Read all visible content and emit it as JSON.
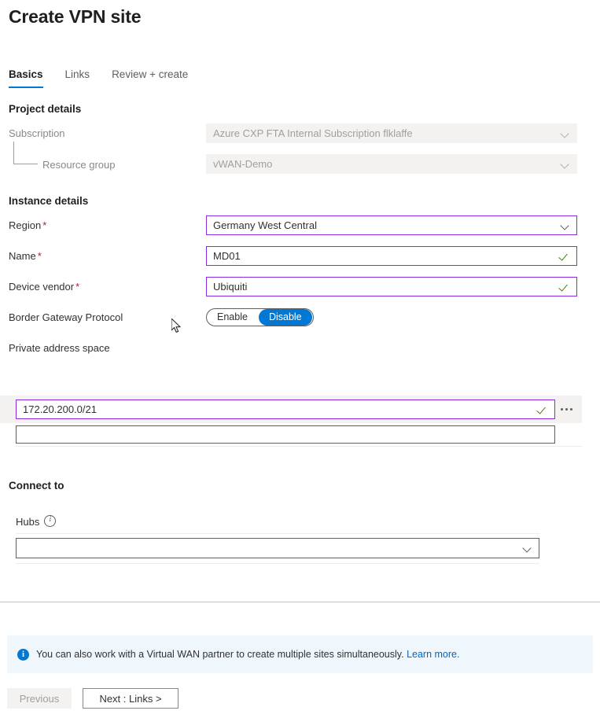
{
  "header": {
    "title": "Create VPN site"
  },
  "tabs": [
    {
      "label": "Basics",
      "active": true
    },
    {
      "label": "Links",
      "active": false
    },
    {
      "label": "Review + create",
      "active": false
    }
  ],
  "project_details": {
    "heading": "Project details",
    "subscription": {
      "label": "Subscription",
      "value": "Azure CXP FTA Internal Subscription flklaffe",
      "disabled": true
    },
    "resource_group": {
      "label": "Resource group",
      "value": "vWAN-Demo",
      "disabled": true
    }
  },
  "instance_details": {
    "heading": "Instance details",
    "region": {
      "label": "Region",
      "required": "*",
      "value": "Germany West Central"
    },
    "name": {
      "label": "Name",
      "required": "*",
      "value": "MD01"
    },
    "device_vendor": {
      "label": "Device vendor",
      "required": "*",
      "value": "Ubiquiti"
    },
    "bgp": {
      "label": "Border Gateway Protocol",
      "enable_label": "Enable",
      "disable_label": "Disable",
      "selected": "Disable"
    },
    "private_address_space": {
      "label": "Private address space",
      "rows": [
        {
          "value": "172.20.200.0/21",
          "valid": true
        },
        {
          "value": "",
          "valid": false
        }
      ],
      "more_label": "..."
    }
  },
  "connect_to": {
    "heading": "Connect to",
    "hubs": {
      "label": "Hubs",
      "info_icon": "info-icon",
      "value": "",
      "placeholder": ""
    }
  },
  "banner": {
    "icon": "info-icon",
    "text": "You can also work with a Virtual WAN partner to create multiple sites simultaneously.",
    "link_text": "Learn more."
  },
  "footer": {
    "previous_label": "Previous",
    "next_label": "Next : Links >"
  },
  "colors": {
    "accent": "#0078d4",
    "field_border_active": "#8a2be2",
    "valid_check": "#498205",
    "required_star": "#a4262c",
    "banner_bg": "#eff6fc",
    "disabled_bg": "#f3f2f1"
  }
}
